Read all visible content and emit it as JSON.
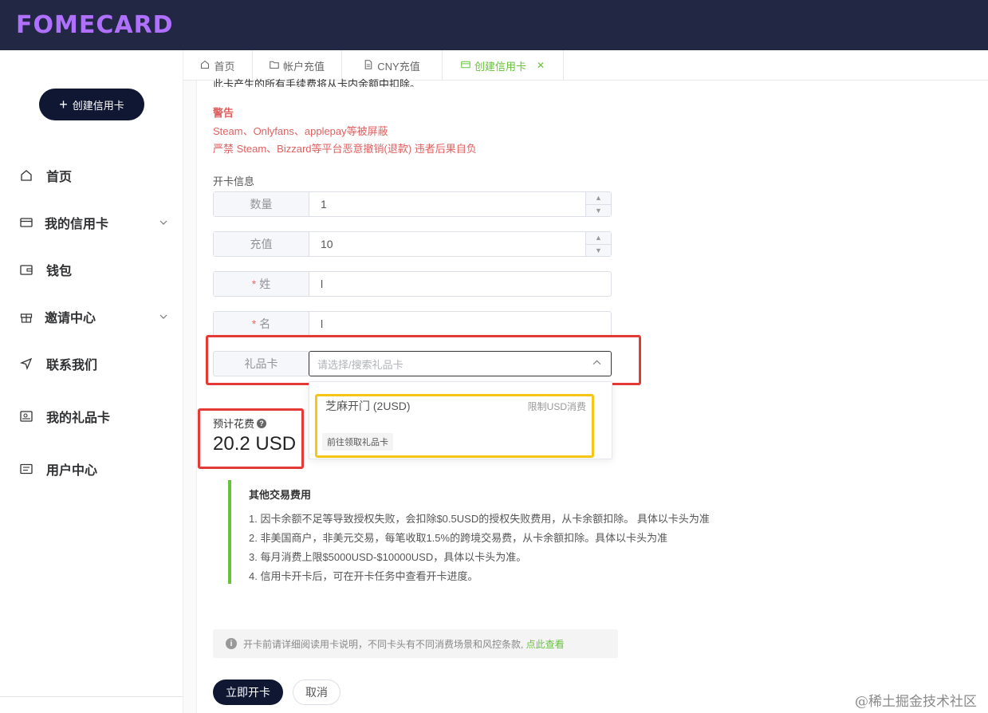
{
  "brand": "FOMECARD",
  "sidebar": {
    "create_button": "创建信用卡",
    "items": [
      {
        "label": "首页",
        "icon": "home-icon"
      },
      {
        "label": "我的信用卡",
        "icon": "credit-card-icon",
        "expandable": true
      },
      {
        "label": "钱包",
        "icon": "wallet-icon"
      },
      {
        "label": "邀请中心",
        "icon": "gift-icon",
        "expandable": true
      },
      {
        "label": "联系我们",
        "icon": "send-icon"
      },
      {
        "label": "我的礼品卡",
        "icon": "gift-card-icon"
      },
      {
        "label": "用户中心",
        "icon": "user-card-icon"
      }
    ]
  },
  "tabs": [
    {
      "label": "首页",
      "icon": "home-icon"
    },
    {
      "label": "帐户充值",
      "icon": "folder-icon"
    },
    {
      "label": "CNY充值",
      "icon": "document-icon"
    },
    {
      "label": "创建信用卡",
      "icon": "card-icon",
      "active": true,
      "closable": true
    }
  ],
  "form": {
    "clipped_text": "此卡产生的所有手续费将从卡内余额中扣除。",
    "warning_title": "警告",
    "warning_lines": [
      "Steam、Onlyfans、applepay等被屏蔽",
      "严禁 Steam、Bizzard等平台恶意撤销(退款) 违者后果自负"
    ],
    "section_label": "开卡信息",
    "fields": {
      "quantity": {
        "label": "数量",
        "value": "1"
      },
      "recharge": {
        "label": "充值",
        "value": "10"
      },
      "last_name": {
        "label": "姓",
        "value": "l",
        "required": true
      },
      "first_name": {
        "label": "名",
        "value": "l",
        "required": true
      },
      "gift_card": {
        "label": "礼品卡",
        "placeholder": "请选择/搜索礼品卡"
      }
    },
    "dropdown": {
      "option": "芝麻开门 (2USD)",
      "option_tag": "限制USD消费",
      "link": "前往领取礼品卡"
    },
    "estimate": {
      "label": "预计花费",
      "value": "20.2 USD"
    },
    "fees": {
      "title": "其他交易费用",
      "lines": [
        "1. 因卡余额不足等导致授权失败，会扣除$0.5USD的授权失败费用，从卡余额扣除。 具体以卡头为准",
        "2. 非美国商户，非美元交易，每笔收取1.5%的跨境交易费，从卡余额扣除。具体以卡头为准",
        "3. 每月消费上限$5000USD-$10000USD，具体以卡头为准。",
        "4. 信用卡开卡后，可在开卡任务中查看开卡进度。"
      ]
    },
    "notice": {
      "text": "开卡前请详细阅读用卡说明，不同卡头有不同消费场景和风控条款, ",
      "link": "点此查看"
    },
    "submit": "立即开卡",
    "cancel": "取消"
  },
  "watermark": "@稀土掘金技术社区",
  "colors": {
    "topbar": "#222843",
    "accent_green": "#67c23a",
    "warning_red": "#e06060",
    "highlight_red": "#e53935",
    "highlight_yellow": "#f5c518"
  }
}
